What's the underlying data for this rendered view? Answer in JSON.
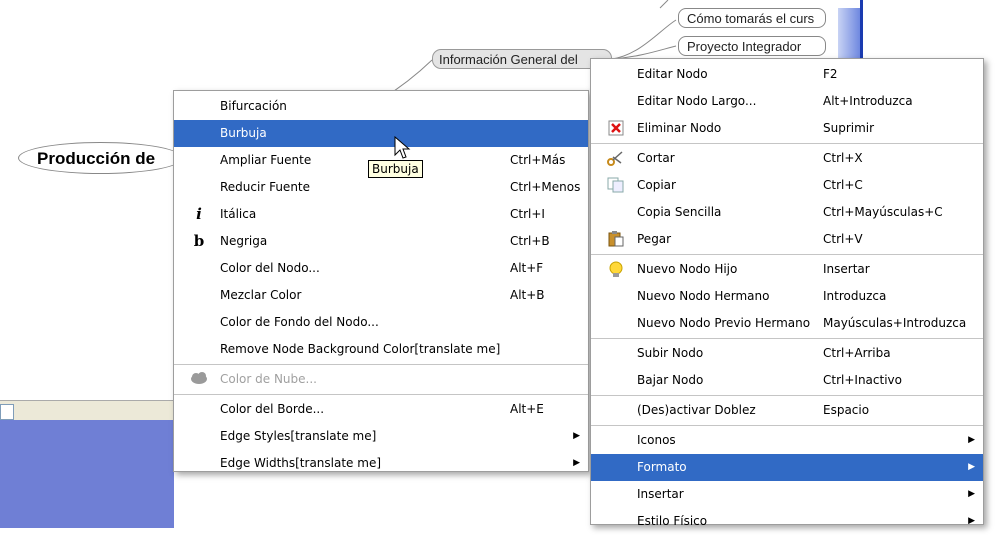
{
  "mindmap": {
    "root": "Producción de",
    "info_node": "Información General del",
    "child1": "Cómo tomarás el curs",
    "child2": "Proyecto Integrador"
  },
  "tooltip": "Burbuja",
  "menu_left": {
    "items": [
      {
        "label": "Bifurcación",
        "shortcut": ""
      },
      {
        "label": "Burbuja",
        "shortcut": "",
        "selected": true
      },
      {
        "label": "Ampliar Fuente",
        "shortcut": "Ctrl+Más"
      },
      {
        "label": "Reducir Fuente",
        "shortcut": "Ctrl+Menos"
      },
      {
        "label": "Itálica",
        "shortcut": "Ctrl+I",
        "icon": "italic-icon"
      },
      {
        "label": "Negriga",
        "shortcut": "Ctrl+B",
        "icon": "bold-icon"
      },
      {
        "label": "Color del Nodo...",
        "shortcut": "Alt+F"
      },
      {
        "label": "Mezclar Color",
        "shortcut": "Alt+B"
      },
      {
        "label": "Color de Fondo del Nodo...",
        "shortcut": ""
      },
      {
        "label": "Remove Node Background Color[translate me]",
        "shortcut": ""
      },
      {
        "label": "Color de Nube...",
        "shortcut": "",
        "disabled": true,
        "icon": "cloud-icon"
      },
      {
        "label": "Color del Borde...",
        "shortcut": "Alt+E"
      },
      {
        "label": "Edge Styles[translate me]",
        "shortcut": "",
        "submenu": true
      },
      {
        "label": "Edge Widths[translate me]",
        "shortcut": "",
        "submenu": true
      }
    ]
  },
  "menu_right": {
    "items": [
      {
        "label": "Editar Nodo",
        "shortcut": "F2"
      },
      {
        "label": "Editar Nodo Largo...",
        "shortcut": "Alt+Introduzca"
      },
      {
        "label": "Eliminar Nodo",
        "shortcut": "Suprimir",
        "icon": "delete-icon"
      },
      {
        "label": "Cortar",
        "shortcut": "Ctrl+X",
        "icon": "scissors-icon"
      },
      {
        "label": "Copiar",
        "shortcut": "Ctrl+C",
        "icon": "copy-icon"
      },
      {
        "label": "Copia Sencilla",
        "shortcut": "Ctrl+Mayúsculas+C"
      },
      {
        "label": "Pegar",
        "shortcut": "Ctrl+V",
        "icon": "paste-icon"
      },
      {
        "label": "Nuevo Nodo Hijo",
        "shortcut": "Insertar",
        "icon": "lightbulb-icon"
      },
      {
        "label": "Nuevo Nodo Hermano",
        "shortcut": "Introduzca"
      },
      {
        "label": "Nuevo Nodo Previo Hermano",
        "shortcut": "Mayúsculas+Introduzca"
      },
      {
        "label": "Subir Nodo",
        "shortcut": "Ctrl+Arriba"
      },
      {
        "label": "Bajar Nodo",
        "shortcut": "Ctrl+Inactivo"
      },
      {
        "label": "(Des)activar Doblez",
        "shortcut": "Espacio"
      },
      {
        "label": "Iconos",
        "shortcut": "",
        "submenu": true
      },
      {
        "label": "Formato",
        "shortcut": "",
        "submenu": true,
        "selected": true
      },
      {
        "label": "Insertar",
        "shortcut": "",
        "submenu": true
      },
      {
        "label": "Estilo Físico",
        "shortcut": "",
        "submenu": true
      }
    ]
  },
  "colors": {
    "selection": "#316ac5",
    "pane_blue": "#6f7fd5"
  }
}
